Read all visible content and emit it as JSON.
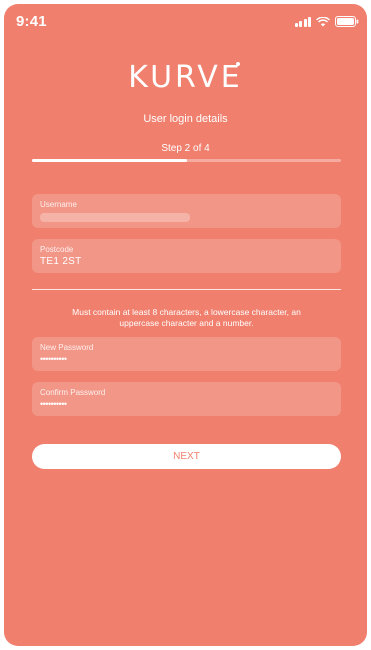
{
  "status_bar": {
    "time": "9:41"
  },
  "header": {
    "logo": "KURVE",
    "subtitle": "User login details",
    "step": "Step 2 of 4",
    "progress_fraction": 0.5
  },
  "form": {
    "username": {
      "label": "Username",
      "value": ""
    },
    "postcode": {
      "label": "Postcode",
      "value": "TE1 2ST"
    },
    "password_hint": "Must contain at least 8 characters, a lowercase character, an uppercase character and a number.",
    "new_password": {
      "label": "New Password",
      "value": "••••••••••"
    },
    "confirm_password": {
      "label": "Confirm Password",
      "value": "••••••••••"
    }
  },
  "actions": {
    "next_label": "NEXT"
  },
  "colors": {
    "background": "#f07f6d",
    "button_text": "#f07f6d",
    "text": "#ffffff"
  }
}
